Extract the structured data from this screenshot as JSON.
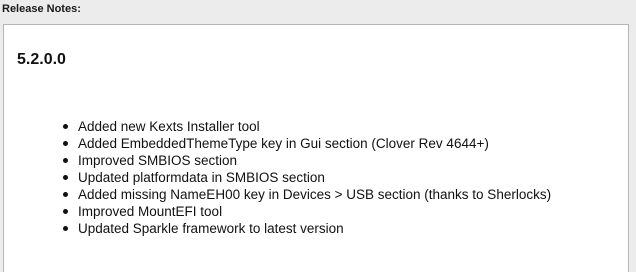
{
  "release_notes": {
    "label": "Release Notes:",
    "version": "5.2.0.0",
    "items": [
      "Added new Kexts Installer tool",
      "Added EmbeddedThemeType key in Gui section (Clover Rev 4644+)",
      "Improved SMBIOS section",
      "Updated platformdata in SMBIOS section",
      "Added missing NameEH00 key in Devices > USB section (thanks to Sherlocks)",
      "Improved MountEFI tool",
      "Updated Sparkle framework to latest version"
    ]
  }
}
